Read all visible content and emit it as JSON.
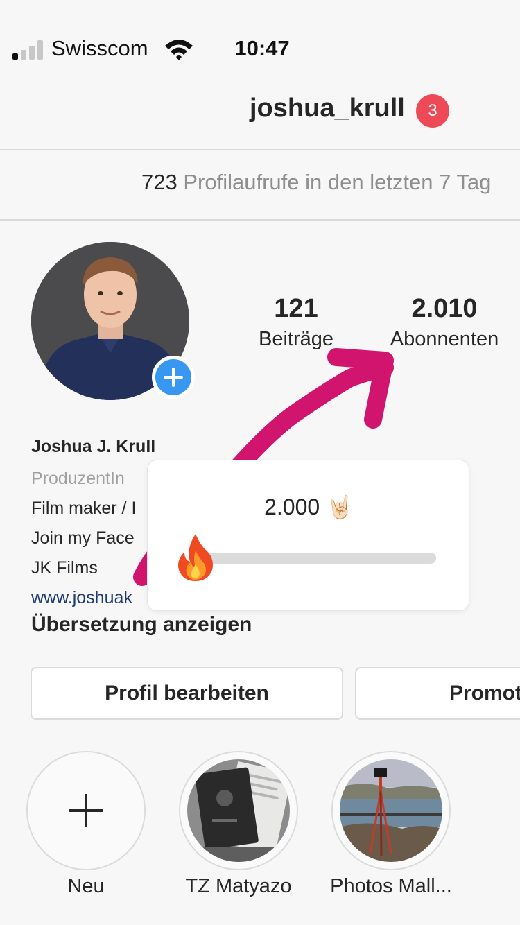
{
  "status_bar": {
    "carrier": "Swisscom",
    "time": "10:47",
    "signal_bars_on": 1,
    "signal_bars_total": 4
  },
  "header": {
    "username": "joshua_krull",
    "notification_count": "3"
  },
  "insights": {
    "count": "723",
    "text": "Profilaufrufe in den letzten 7 Tag"
  },
  "stats": {
    "posts": {
      "value": "121",
      "label": "Beiträge"
    },
    "followers": {
      "value": "2.010",
      "label": "Abonnenten"
    }
  },
  "bio": {
    "name": "Joshua J. Krull",
    "category": "ProduzentIn",
    "line1": "Film maker / I",
    "line2": "Join my Face",
    "line3": "JK Films",
    "link": "www.joshuak",
    "translate": "Übersetzung anzeigen"
  },
  "buttons": {
    "edit_profile": "Profil bearbeiten",
    "promote": "Promot"
  },
  "highlights": [
    {
      "label": "Neu",
      "icon": "plus-icon"
    },
    {
      "label": "TZ Matyazo",
      "icon": "passport-photo"
    },
    {
      "label": "Photos Mall...",
      "icon": "tripod-photo"
    }
  ],
  "sticker": {
    "text": "2.000 🤘🏻",
    "slider_value": 0.06,
    "emoji": "flame-icon"
  },
  "colors": {
    "accent_blue": "#3897f0",
    "badge_red": "#ed4956",
    "arrow_magenta": "#d1156e",
    "link_blue": "#1e3a70"
  }
}
